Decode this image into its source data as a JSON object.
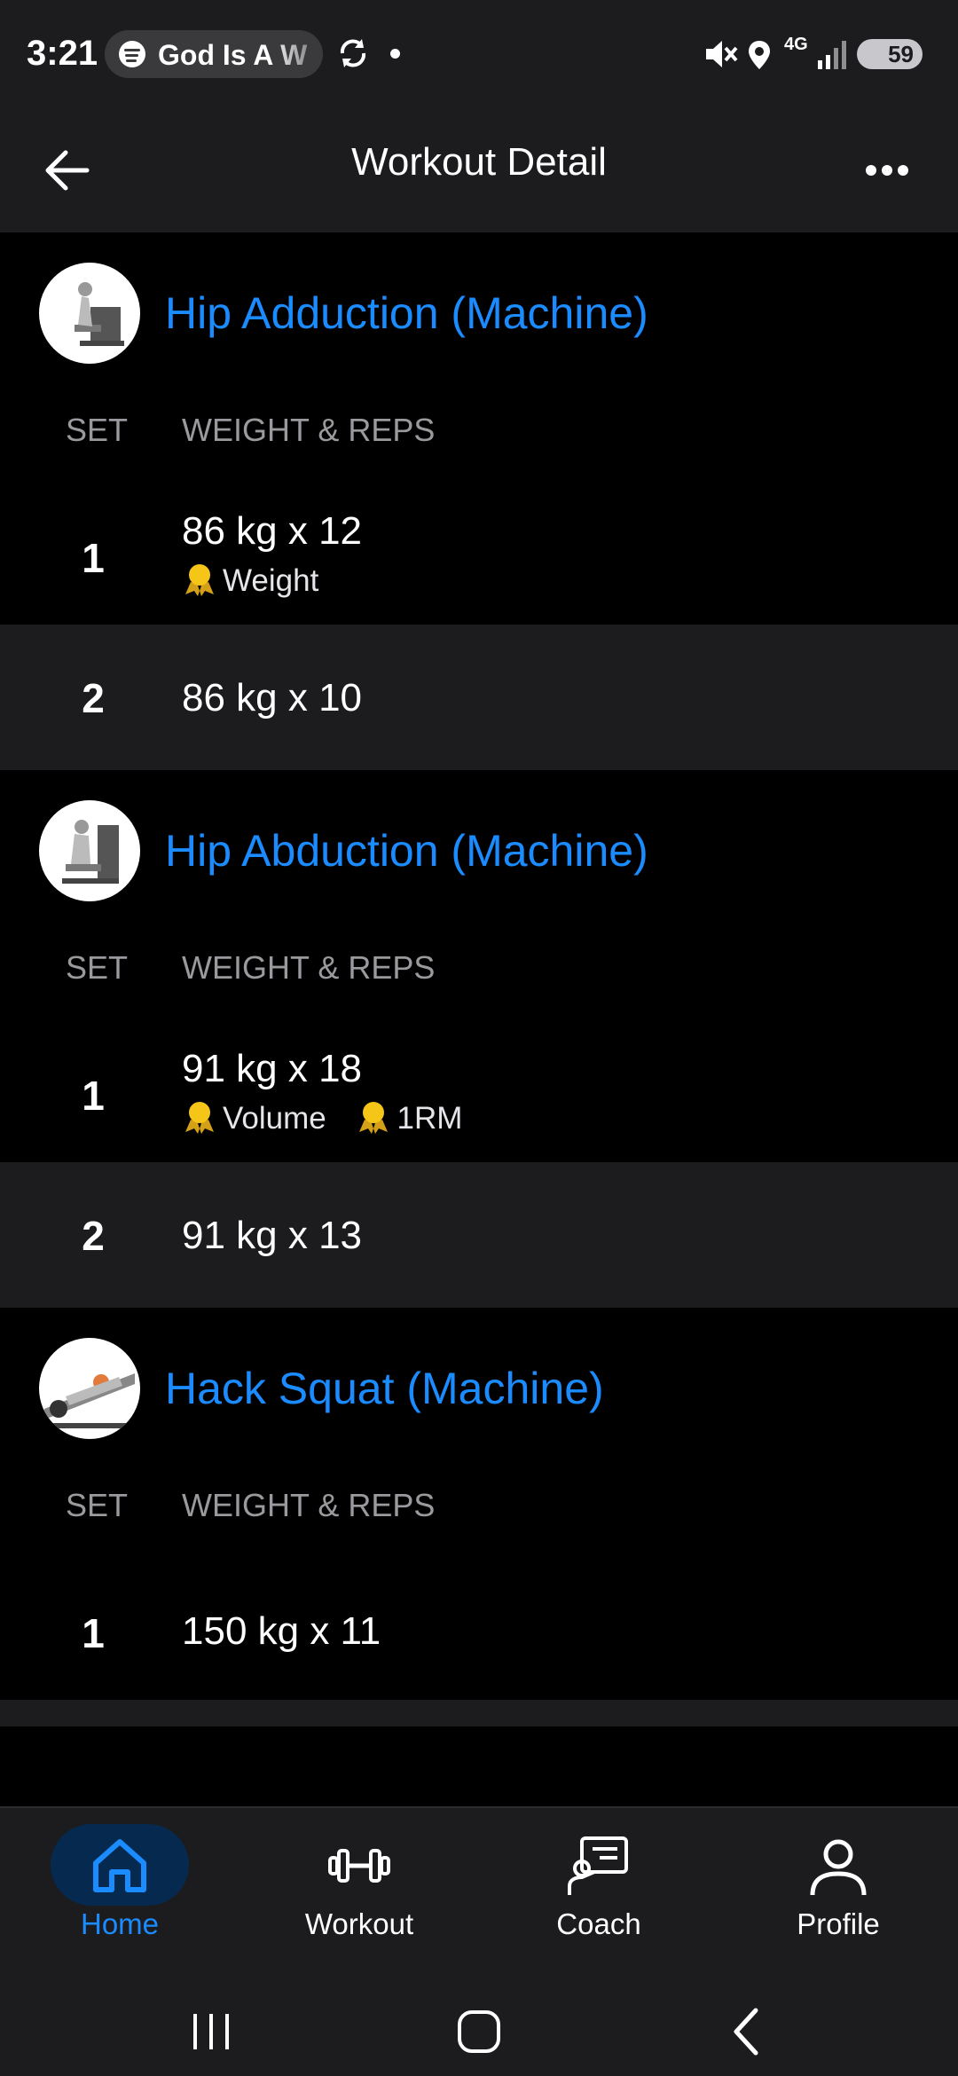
{
  "status_bar": {
    "time": "3:21",
    "media_text": "God Is A W",
    "network": "4G",
    "battery": "59"
  },
  "header": {
    "title": "Workout Detail"
  },
  "exercises": [
    {
      "name": "Hip Adduction (Machine)",
      "col_set": "SET",
      "col_weight_reps": "WEIGHT & REPS",
      "sets": [
        {
          "set": "1",
          "value": "86 kg x 12",
          "badges": [
            "Weight"
          ]
        },
        {
          "set": "2",
          "value": "86 kg x 10",
          "badges": []
        }
      ]
    },
    {
      "name": "Hip Abduction (Machine)",
      "col_set": "SET",
      "col_weight_reps": "WEIGHT & REPS",
      "sets": [
        {
          "set": "1",
          "value": "91 kg x 18",
          "badges": [
            "Volume",
            "1RM"
          ]
        },
        {
          "set": "2",
          "value": "91 kg x 13",
          "badges": []
        }
      ]
    },
    {
      "name": "Hack Squat (Machine)",
      "col_set": "SET",
      "col_weight_reps": "WEIGHT & REPS",
      "sets": [
        {
          "set": "1",
          "value": "150 kg x 11",
          "badges": []
        }
      ]
    }
  ],
  "bottom_nav": {
    "items": [
      {
        "label": "Home",
        "icon": "home-icon",
        "active": true
      },
      {
        "label": "Workout",
        "icon": "dumbbell-icon",
        "active": false
      },
      {
        "label": "Coach",
        "icon": "coach-icon",
        "active": false
      },
      {
        "label": "Profile",
        "icon": "profile-icon",
        "active": false
      }
    ]
  },
  "colors": {
    "accent": "#1a8cff",
    "background": "#000000",
    "surface": "#1c1c1e",
    "medal": "#f5c518"
  }
}
